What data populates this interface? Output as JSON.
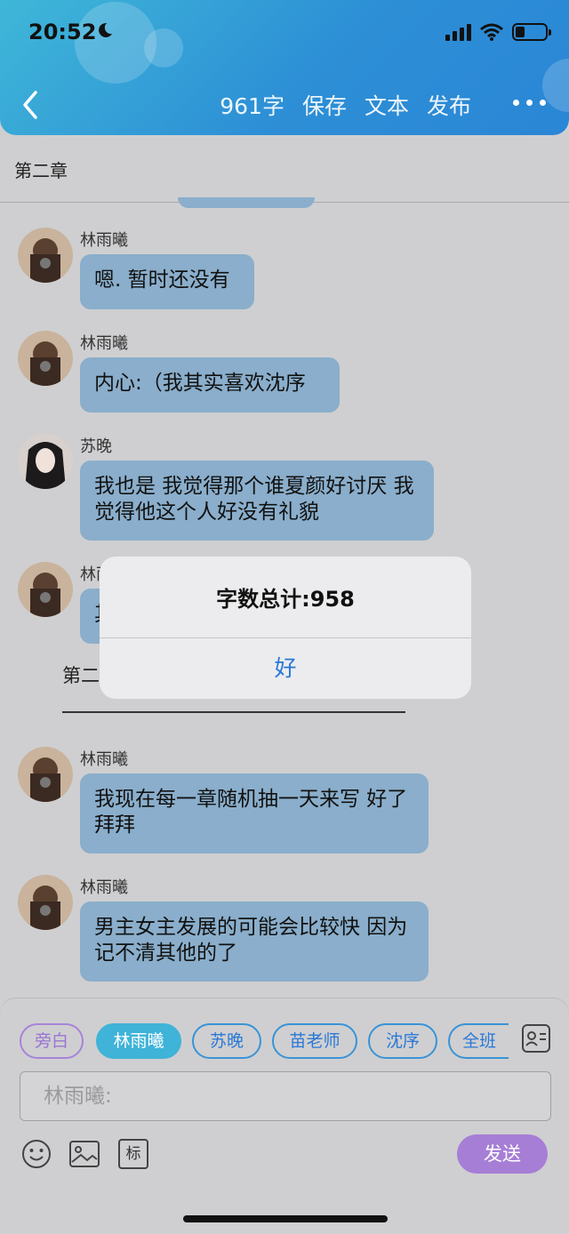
{
  "status_bar": {
    "time": "20:52"
  },
  "nav": {
    "word_count": "961字",
    "save": "保存",
    "text": "文本",
    "publish": "发布"
  },
  "chapter_title": "第二章",
  "messages": [
    {
      "name": "林雨曦",
      "text": "嗯. 暂时还没有"
    },
    {
      "name": "林雨曦",
      "text": "内心:（我其实喜欢沈序"
    },
    {
      "name": "苏晚",
      "text": "我也是 我觉得那个谁夏颜好讨厌 我觉得他这个人好没有礼貌"
    },
    {
      "name": "林雨曦",
      "text": "其"
    },
    {
      "name": "林雨曦",
      "text": "我现在每一章随机抽一天来写 好了拜拜"
    },
    {
      "name": "林雨曦",
      "text": "男主女主发展的可能会比较快 因为记不清其他的了"
    }
  ],
  "narration": "第二",
  "dialog": {
    "title": "字数总计:958",
    "ok": "好"
  },
  "roles": [
    "旁白",
    "林雨曦",
    "苏晚",
    "苗老师",
    "沈序",
    "全班"
  ],
  "input": {
    "placeholder": "林雨曦:"
  },
  "toolbar": {
    "tag_icon_label": "标",
    "send_label": "发送"
  }
}
